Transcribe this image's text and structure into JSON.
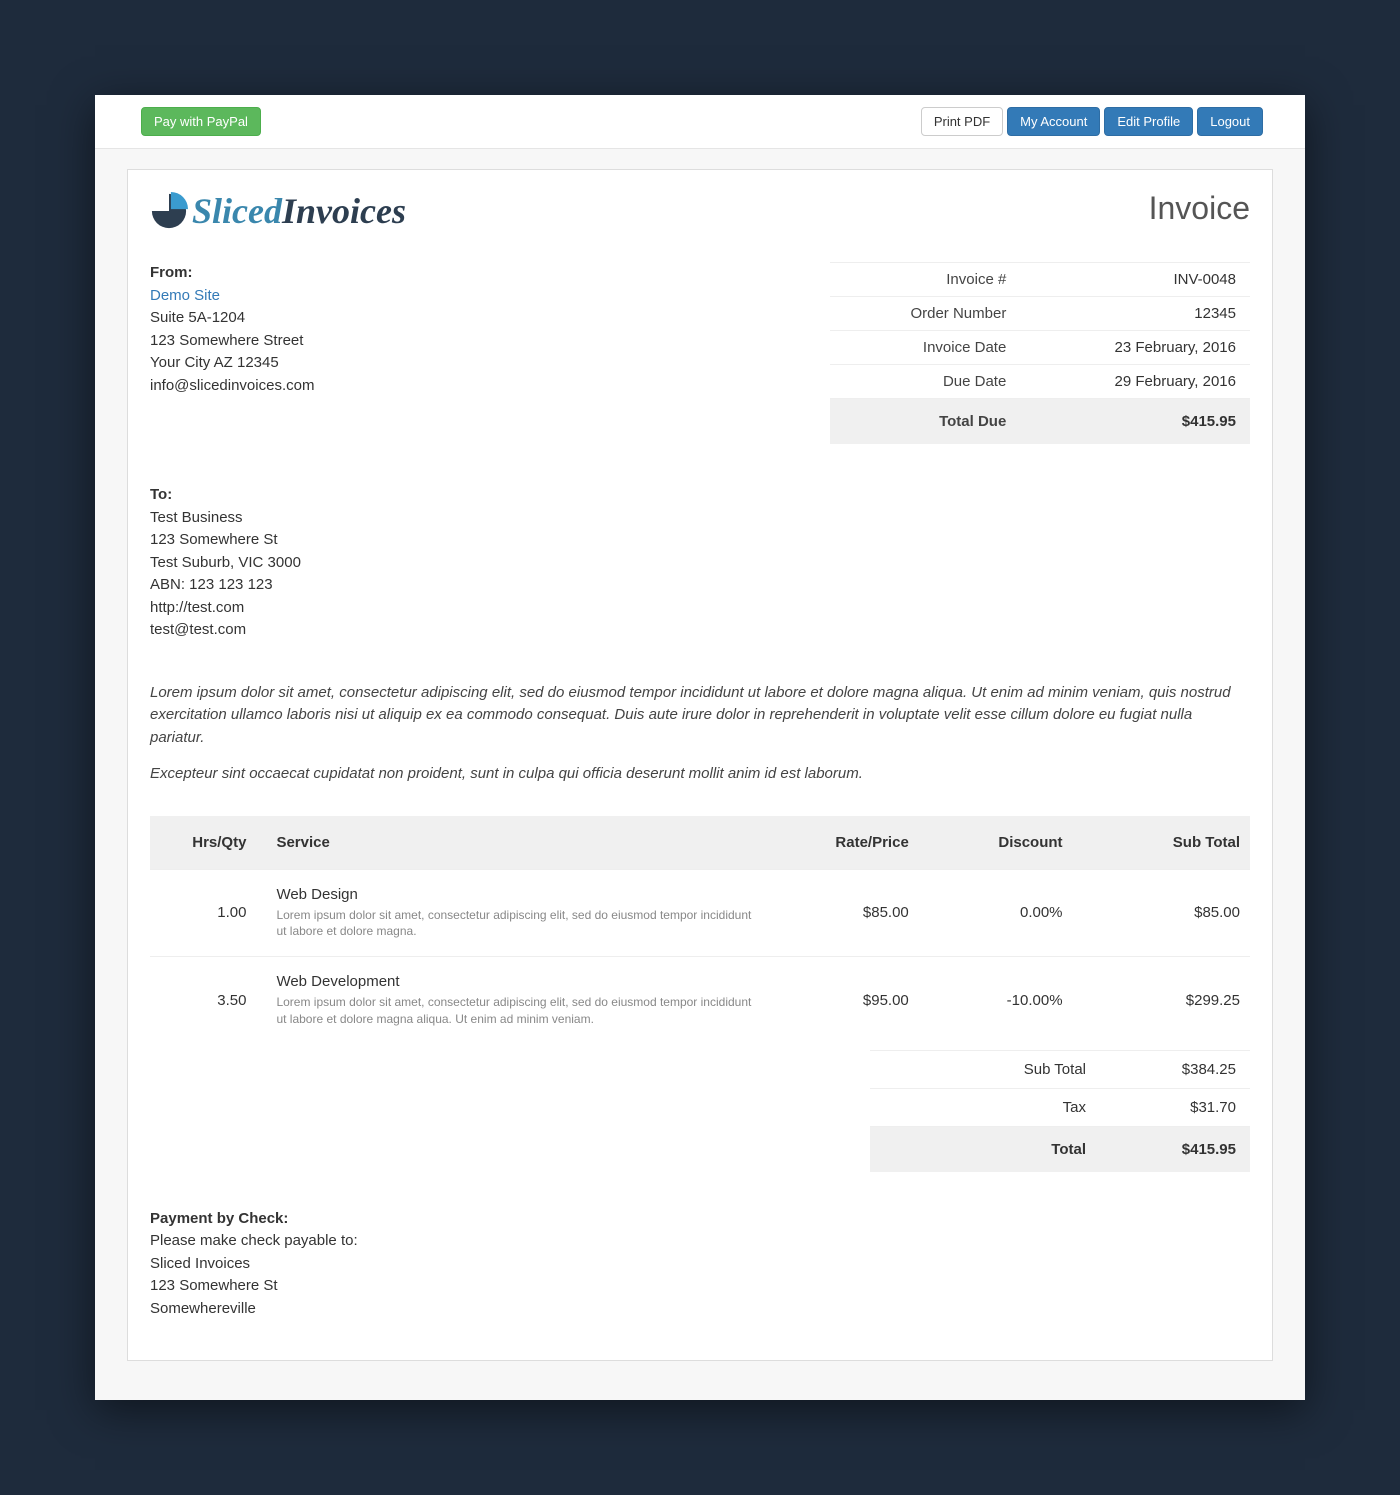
{
  "topbar": {
    "pay_label": "Pay with PayPal",
    "print_label": "Print PDF",
    "account_label": "My Account",
    "edit_label": "Edit Profile",
    "logout_label": "Logout"
  },
  "logo": {
    "word1": "Sliced",
    "word2": "Invoices"
  },
  "doc_title": "Invoice",
  "from": {
    "label": "From:",
    "site": "Demo Site",
    "line1": "Suite 5A-1204",
    "line2": "123 Somewhere Street",
    "line3": "Your City AZ 12345",
    "email": "info@slicedinvoices.com"
  },
  "meta": {
    "invoice_num_label": "Invoice #",
    "invoice_num": "INV-0048",
    "order_label": "Order Number",
    "order": "12345",
    "inv_date_label": "Invoice Date",
    "inv_date": "23 February, 2016",
    "due_date_label": "Due Date",
    "due_date": "29 February, 2016",
    "total_due_label": "Total Due",
    "total_due": "$415.95"
  },
  "to": {
    "label": "To:",
    "name": "Test Business",
    "line1": "123 Somewhere St",
    "line2": "Test Suburb, VIC 3000",
    "abn": "ABN: 123 123 123",
    "url": "http://test.com",
    "email": "test@test.com"
  },
  "description": {
    "p1": "Lorem ipsum dolor sit amet, consectetur adipiscing elit, sed do eiusmod tempor incididunt ut labore et dolore magna aliqua. Ut enim ad minim veniam, quis nostrud exercitation ullamco laboris nisi ut aliquip ex ea commodo consequat. Duis aute irure dolor in reprehenderit in voluptate velit esse cillum dolore eu fugiat nulla pariatur.",
    "p2": "Excepteur sint occaecat cupidatat non proident, sunt in culpa qui officia deserunt mollit anim id est laborum."
  },
  "items": {
    "header": {
      "qty": "Hrs/Qty",
      "service": "Service",
      "rate": "Rate/Price",
      "discount": "Discount",
      "subtotal": "Sub Total"
    },
    "rows": [
      {
        "qty": "1.00",
        "name": "Web Design",
        "desc": "Lorem ipsum dolor sit amet, consectetur adipiscing elit, sed do eiusmod tempor incididunt ut labore et dolore magna.",
        "rate": "$85.00",
        "discount": "0.00%",
        "subtotal": "$85.00"
      },
      {
        "qty": "3.50",
        "name": "Web Development",
        "desc": "Lorem ipsum dolor sit amet, consectetur adipiscing elit, sed do eiusmod tempor incididunt ut labore et dolore magna aliqua. Ut enim ad minim veniam.",
        "rate": "$95.00",
        "discount": "-10.00%",
        "subtotal": "$299.25"
      }
    ]
  },
  "totals": {
    "sub_label": "Sub Total",
    "sub": "$384.25",
    "tax_label": "Tax",
    "tax": "$31.70",
    "total_label": "Total",
    "total": "$415.95"
  },
  "payment": {
    "label": "Payment by Check:",
    "line1": "Please make check payable to:",
    "line2": "Sliced Invoices",
    "line3": "123 Somewhere St",
    "line4": "Somewhereville"
  }
}
